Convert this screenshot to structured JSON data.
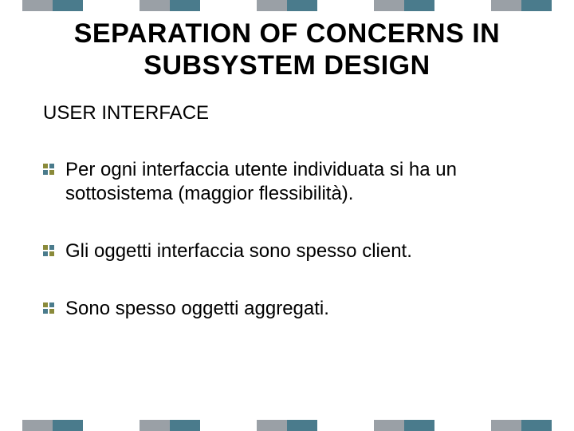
{
  "title": "SEPARATION OF CONCERNS IN SUBSYSTEM DESIGN",
  "subtitle": "USER INTERFACE",
  "bullets": [
    "Per ogni interfaccia utente individuata si ha un sottosistema (maggior flessibilità).",
    "Gli oggetti interfaccia sono spesso client.",
    "Sono spesso oggetti aggregati."
  ],
  "colors": {
    "accent_gray": "#9aa0a6",
    "accent_teal": "#4a7b8c",
    "bullet_olive": "#8a8a3a",
    "bullet_teal": "#4a7b8c"
  }
}
